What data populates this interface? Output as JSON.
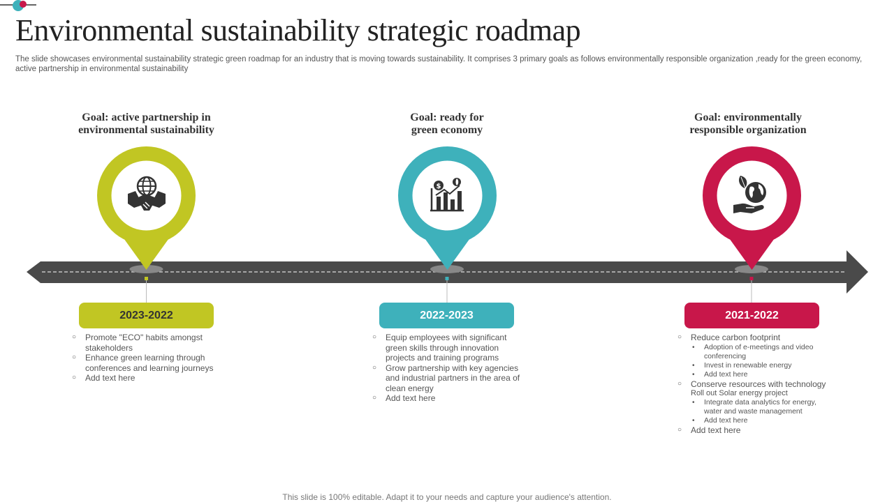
{
  "title": "Environmental sustainability strategic roadmap",
  "subtitle": "The slide showcases environmental sustainability strategic green roadmap for an industry that is moving towards sustainability. It comprises 3 primary goals as follows environmentally responsible organization ,ready for the green economy, active partnership in environmental sustainability",
  "colors": {
    "green": "#c1c623",
    "teal": "#3eb1bb",
    "red": "#c8174a",
    "road": "#4a4a4a"
  },
  "goals": [
    {
      "title_line1": "Goal: active partnership in",
      "title_line2": "environmental sustainability",
      "icon": "handshake-globe-icon",
      "year": "2023-2022",
      "items": [
        {
          "text": "Promote \"ECO\" habits amongst stakeholders"
        },
        {
          "text": "Enhance green learning through conferences and learning journeys"
        },
        {
          "text": "Add text here"
        }
      ]
    },
    {
      "title_line1": "Goal: ready for",
      "title_line2": "green economy",
      "icon": "growth-chart-icon",
      "year": "2022-2023",
      "items": [
        {
          "text": "Equip employees with significant green skills through innovation projects and training programs"
        },
        {
          "text": "Grow partnership with key agencies and industrial partners in the area of clean energy"
        },
        {
          "text": "Add text here"
        }
      ]
    },
    {
      "title_line1": "Goal: environmentally",
      "title_line2": "responsible organization",
      "icon": "hand-globe-leaf-icon",
      "year": "2021-2022",
      "items": [
        {
          "text": "Reduce carbon footprint",
          "sub": [
            "Adoption of e-meetings and video conferencing",
            "Invest in renewable energy",
            "Add text here"
          ]
        },
        {
          "text": "Conserve resources with technology",
          "note": "Roll out Solar energy project",
          "sub": [
            "Integrate data analytics for energy, water and waste management",
            "Add text here"
          ]
        },
        {
          "text": "Add text here"
        }
      ]
    }
  ],
  "footer": "This slide is 100% editable. Adapt it to your needs and capture your audience's attention."
}
